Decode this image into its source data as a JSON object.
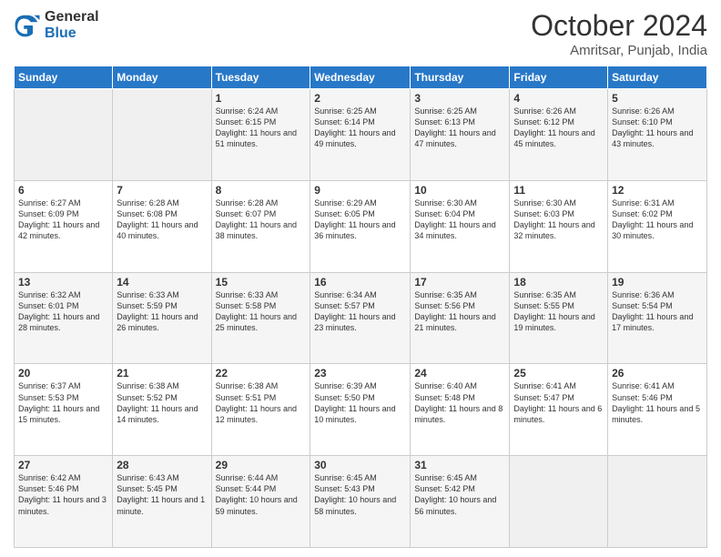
{
  "logo": {
    "general": "General",
    "blue": "Blue"
  },
  "header": {
    "month": "October 2024",
    "location": "Amritsar, Punjab, India"
  },
  "days_of_week": [
    "Sunday",
    "Monday",
    "Tuesday",
    "Wednesday",
    "Thursday",
    "Friday",
    "Saturday"
  ],
  "weeks": [
    [
      {
        "day": "",
        "empty": true
      },
      {
        "day": "",
        "empty": true
      },
      {
        "day": "1",
        "sunrise": "Sunrise: 6:24 AM",
        "sunset": "Sunset: 6:15 PM",
        "daylight": "Daylight: 11 hours and 51 minutes."
      },
      {
        "day": "2",
        "sunrise": "Sunrise: 6:25 AM",
        "sunset": "Sunset: 6:14 PM",
        "daylight": "Daylight: 11 hours and 49 minutes."
      },
      {
        "day": "3",
        "sunrise": "Sunrise: 6:25 AM",
        "sunset": "Sunset: 6:13 PM",
        "daylight": "Daylight: 11 hours and 47 minutes."
      },
      {
        "day": "4",
        "sunrise": "Sunrise: 6:26 AM",
        "sunset": "Sunset: 6:12 PM",
        "daylight": "Daylight: 11 hours and 45 minutes."
      },
      {
        "day": "5",
        "sunrise": "Sunrise: 6:26 AM",
        "sunset": "Sunset: 6:10 PM",
        "daylight": "Daylight: 11 hours and 43 minutes."
      }
    ],
    [
      {
        "day": "6",
        "sunrise": "Sunrise: 6:27 AM",
        "sunset": "Sunset: 6:09 PM",
        "daylight": "Daylight: 11 hours and 42 minutes."
      },
      {
        "day": "7",
        "sunrise": "Sunrise: 6:28 AM",
        "sunset": "Sunset: 6:08 PM",
        "daylight": "Daylight: 11 hours and 40 minutes."
      },
      {
        "day": "8",
        "sunrise": "Sunrise: 6:28 AM",
        "sunset": "Sunset: 6:07 PM",
        "daylight": "Daylight: 11 hours and 38 minutes."
      },
      {
        "day": "9",
        "sunrise": "Sunrise: 6:29 AM",
        "sunset": "Sunset: 6:05 PM",
        "daylight": "Daylight: 11 hours and 36 minutes."
      },
      {
        "day": "10",
        "sunrise": "Sunrise: 6:30 AM",
        "sunset": "Sunset: 6:04 PM",
        "daylight": "Daylight: 11 hours and 34 minutes."
      },
      {
        "day": "11",
        "sunrise": "Sunrise: 6:30 AM",
        "sunset": "Sunset: 6:03 PM",
        "daylight": "Daylight: 11 hours and 32 minutes."
      },
      {
        "day": "12",
        "sunrise": "Sunrise: 6:31 AM",
        "sunset": "Sunset: 6:02 PM",
        "daylight": "Daylight: 11 hours and 30 minutes."
      }
    ],
    [
      {
        "day": "13",
        "sunrise": "Sunrise: 6:32 AM",
        "sunset": "Sunset: 6:01 PM",
        "daylight": "Daylight: 11 hours and 28 minutes."
      },
      {
        "day": "14",
        "sunrise": "Sunrise: 6:33 AM",
        "sunset": "Sunset: 5:59 PM",
        "daylight": "Daylight: 11 hours and 26 minutes."
      },
      {
        "day": "15",
        "sunrise": "Sunrise: 6:33 AM",
        "sunset": "Sunset: 5:58 PM",
        "daylight": "Daylight: 11 hours and 25 minutes."
      },
      {
        "day": "16",
        "sunrise": "Sunrise: 6:34 AM",
        "sunset": "Sunset: 5:57 PM",
        "daylight": "Daylight: 11 hours and 23 minutes."
      },
      {
        "day": "17",
        "sunrise": "Sunrise: 6:35 AM",
        "sunset": "Sunset: 5:56 PM",
        "daylight": "Daylight: 11 hours and 21 minutes."
      },
      {
        "day": "18",
        "sunrise": "Sunrise: 6:35 AM",
        "sunset": "Sunset: 5:55 PM",
        "daylight": "Daylight: 11 hours and 19 minutes."
      },
      {
        "day": "19",
        "sunrise": "Sunrise: 6:36 AM",
        "sunset": "Sunset: 5:54 PM",
        "daylight": "Daylight: 11 hours and 17 minutes."
      }
    ],
    [
      {
        "day": "20",
        "sunrise": "Sunrise: 6:37 AM",
        "sunset": "Sunset: 5:53 PM",
        "daylight": "Daylight: 11 hours and 15 minutes."
      },
      {
        "day": "21",
        "sunrise": "Sunrise: 6:38 AM",
        "sunset": "Sunset: 5:52 PM",
        "daylight": "Daylight: 11 hours and 14 minutes."
      },
      {
        "day": "22",
        "sunrise": "Sunrise: 6:38 AM",
        "sunset": "Sunset: 5:51 PM",
        "daylight": "Daylight: 11 hours and 12 minutes."
      },
      {
        "day": "23",
        "sunrise": "Sunrise: 6:39 AM",
        "sunset": "Sunset: 5:50 PM",
        "daylight": "Daylight: 11 hours and 10 minutes."
      },
      {
        "day": "24",
        "sunrise": "Sunrise: 6:40 AM",
        "sunset": "Sunset: 5:48 PM",
        "daylight": "Daylight: 11 hours and 8 minutes."
      },
      {
        "day": "25",
        "sunrise": "Sunrise: 6:41 AM",
        "sunset": "Sunset: 5:47 PM",
        "daylight": "Daylight: 11 hours and 6 minutes."
      },
      {
        "day": "26",
        "sunrise": "Sunrise: 6:41 AM",
        "sunset": "Sunset: 5:46 PM",
        "daylight": "Daylight: 11 hours and 5 minutes."
      }
    ],
    [
      {
        "day": "27",
        "sunrise": "Sunrise: 6:42 AM",
        "sunset": "Sunset: 5:46 PM",
        "daylight": "Daylight: 11 hours and 3 minutes."
      },
      {
        "day": "28",
        "sunrise": "Sunrise: 6:43 AM",
        "sunset": "Sunset: 5:45 PM",
        "daylight": "Daylight: 11 hours and 1 minute."
      },
      {
        "day": "29",
        "sunrise": "Sunrise: 6:44 AM",
        "sunset": "Sunset: 5:44 PM",
        "daylight": "Daylight: 10 hours and 59 minutes."
      },
      {
        "day": "30",
        "sunrise": "Sunrise: 6:45 AM",
        "sunset": "Sunset: 5:43 PM",
        "daylight": "Daylight: 10 hours and 58 minutes."
      },
      {
        "day": "31",
        "sunrise": "Sunrise: 6:45 AM",
        "sunset": "Sunset: 5:42 PM",
        "daylight": "Daylight: 10 hours and 56 minutes."
      },
      {
        "day": "",
        "empty": true
      },
      {
        "day": "",
        "empty": true
      }
    ]
  ]
}
